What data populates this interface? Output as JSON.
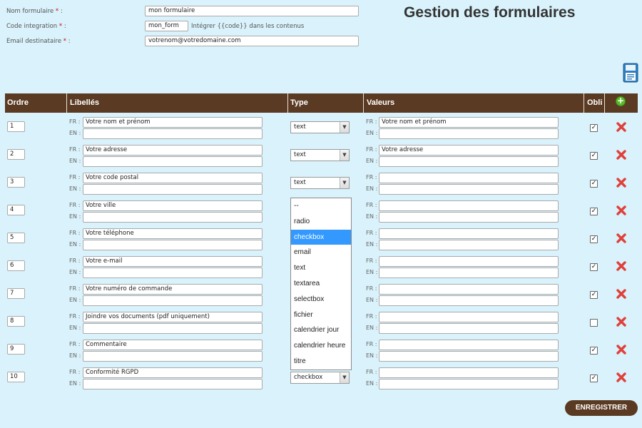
{
  "form": {
    "name_label": "Nom formulaire",
    "name_value": "mon formulaire",
    "code_label": "Code integration",
    "code_value": "mon_form",
    "code_hint": "Intégrer {{code}} dans les contenus",
    "email_label": "Email destinataire",
    "email_value": "votrenom@votredomaine.com",
    "required_mark": "*",
    "colon": ":"
  },
  "page_title": "Gestion des formulaires",
  "columns": {
    "ordre": "Ordre",
    "libelles": "Libellés",
    "type": "Type",
    "valeurs": "Valeurs",
    "obli": "Obli",
    "add_glyph": "+"
  },
  "lang": {
    "fr": "FR :",
    "en": "EN :"
  },
  "rows": [
    {
      "ordre": "1",
      "libelle_fr": "Votre nom et prénom",
      "libelle_en": "",
      "type": "text",
      "valeur_fr": "Votre nom et prénom",
      "valeur_en": "",
      "obligatoire": true,
      "check_glyph": "✓"
    },
    {
      "ordre": "2",
      "libelle_fr": "Votre adresse",
      "libelle_en": "",
      "type": "text",
      "valeur_fr": "Votre adresse",
      "valeur_en": "",
      "obligatoire": true,
      "check_glyph": "✓"
    },
    {
      "ordre": "3",
      "libelle_fr": "Votre code postal",
      "libelle_en": "",
      "type": "text",
      "valeur_fr": "",
      "valeur_en": "",
      "obligatoire": true,
      "check_glyph": "✓"
    },
    {
      "ordre": "4",
      "libelle_fr": "Votre ville",
      "libelle_en": "",
      "type": "",
      "valeur_fr": "",
      "valeur_en": "",
      "obligatoire": true,
      "check_glyph": "✓"
    },
    {
      "ordre": "5",
      "libelle_fr": "Votre téléphone",
      "libelle_en": "",
      "type": "",
      "valeur_fr": "",
      "valeur_en": "",
      "obligatoire": true,
      "check_glyph": "✓"
    },
    {
      "ordre": "6",
      "libelle_fr": "Votre e-mail",
      "libelle_en": "",
      "type": "",
      "valeur_fr": "",
      "valeur_en": "",
      "obligatoire": true,
      "check_glyph": "✓"
    },
    {
      "ordre": "7",
      "libelle_fr": "Votre numéro de commande",
      "libelle_en": "",
      "type": "",
      "valeur_fr": "",
      "valeur_en": "",
      "obligatoire": true,
      "check_glyph": "✓"
    },
    {
      "ordre": "8",
      "libelle_fr": "Joindre vos documents (pdf uniquement)",
      "libelle_en": "",
      "type": "",
      "valeur_fr": "",
      "valeur_en": "",
      "obligatoire": false,
      "check_glyph": ""
    },
    {
      "ordre": "9",
      "libelle_fr": "Commentaire",
      "libelle_en": "",
      "type": "",
      "valeur_fr": "",
      "valeur_en": "",
      "obligatoire": true,
      "check_glyph": "✓"
    },
    {
      "ordre": "10",
      "libelle_fr": "Conformité RGPD",
      "libelle_en": "",
      "type": "checkbox",
      "valeur_fr": "",
      "valeur_en": "",
      "obligatoire": true,
      "check_glyph": "✓"
    }
  ],
  "type_options": [
    "--",
    "radio",
    "checkbox",
    "email",
    "text",
    "textarea",
    "selectbox",
    "fichier",
    "calendrier jour",
    "calendrier heure",
    "titre"
  ],
  "dropdown_selected": "checkbox",
  "save_label": "ENREGISTRER",
  "colors": {
    "header_bg": "#5a3a22",
    "page_bg": "#d9f2fb",
    "delete": "#e0403a",
    "add": "#5bb829",
    "selected": "#3399ff"
  },
  "icons": {
    "save": "save-icon",
    "add": "add-icon",
    "delete": "delete-icon",
    "select_arrow": "chevron-down-icon"
  }
}
